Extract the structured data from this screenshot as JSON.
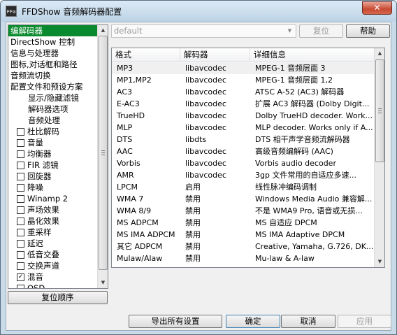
{
  "window": {
    "title": "FFDShow 音频解码器配置",
    "icon_label": "FFa",
    "close_label": "✕"
  },
  "tree": {
    "items": [
      {
        "label": "编解码器",
        "kind": "top",
        "selected": true
      },
      {
        "label": "DirectShow 控制",
        "kind": "top"
      },
      {
        "label": "信息与处理器",
        "kind": "top"
      },
      {
        "label": "图标,对话框和路径",
        "kind": "top"
      },
      {
        "label": "音频流切换",
        "kind": "top"
      },
      {
        "label": "配置文件和预设方案",
        "kind": "top"
      },
      {
        "label": "显示/隐藏滤镜",
        "kind": "sub"
      },
      {
        "label": "解码器选项",
        "kind": "sub"
      },
      {
        "label": "音频处理",
        "kind": "sub"
      },
      {
        "label": "杜比解码",
        "kind": "check",
        "checked": false
      },
      {
        "label": "音量",
        "kind": "check",
        "checked": false
      },
      {
        "label": "均衡器",
        "kind": "check",
        "checked": false
      },
      {
        "label": "FIR 滤镜",
        "kind": "check",
        "checked": false
      },
      {
        "label": "回旋器",
        "kind": "check",
        "checked": false
      },
      {
        "label": "降噪",
        "kind": "check",
        "checked": false
      },
      {
        "label": "Winamp 2",
        "kind": "check",
        "checked": false
      },
      {
        "label": "声场效果",
        "kind": "check",
        "checked": false
      },
      {
        "label": "晶化效果",
        "kind": "check",
        "checked": false
      },
      {
        "label": "重采样",
        "kind": "check",
        "checked": false
      },
      {
        "label": "延迟",
        "kind": "check",
        "checked": false
      },
      {
        "label": "低音交叠",
        "kind": "check",
        "checked": false
      },
      {
        "label": "交换声道",
        "kind": "check",
        "checked": false
      },
      {
        "label": "混音",
        "kind": "check",
        "checked": true
      },
      {
        "label": "OSD",
        "kind": "check",
        "checked": false
      }
    ],
    "reset_order_label": "复位顺序"
  },
  "preset": {
    "value": "default",
    "reset_label": "复位",
    "help_label": "帮助"
  },
  "table": {
    "headers": [
      "格式",
      "解码器",
      "详细信息"
    ],
    "rows": [
      [
        "MP3",
        "libavcodec",
        "MPEG-1 音频层面 3"
      ],
      [
        "MP1,MP2",
        "libavcodec",
        "MPEG-1 音频层面 1,2"
      ],
      [
        "AC3",
        "libavcodec",
        "ATSC A-52 (AC3) 解码器"
      ],
      [
        "E-AC3",
        "libavcodec",
        "扩展 AC3 解码器 (Dolby Digit..."
      ],
      [
        "TrueHD",
        "libavcodec",
        "Dolby TrueHD decoder. Work..."
      ],
      [
        "MLP",
        "libavcodec",
        "MLP decoder. Works only if A..."
      ],
      [
        "DTS",
        "libdts",
        "DTS 相干声学音频流解码器"
      ],
      [
        "AAC",
        "libavcodec",
        "高级音频编解码 (AAC)"
      ],
      [
        "Vorbis",
        "libavcodec",
        "Vorbis audio decoder"
      ],
      [
        "AMR",
        "libavcodec",
        "3gp 文件常用的自适应多速..."
      ],
      [
        "LPCM",
        "启用",
        "线性脉冲编码调制"
      ],
      [
        "WMA 7",
        "禁用",
        "Windows Media Audio 兼容解..."
      ],
      [
        "WMA 8/9",
        "禁用",
        "不是 WMA9 Pro, 语音或无损..."
      ],
      [
        "MS ADPCM",
        "禁用",
        "MS 自适应 DPCM"
      ],
      [
        "MS IMA ADPCM",
        "禁用",
        "MS IMA Adaptive DPCM"
      ],
      [
        "其它 ADPCM",
        "禁用",
        "Creative, Yamaha, G.726, DK..."
      ],
      [
        "Mulaw/Alaw",
        "禁用",
        "Mu-law & A-law"
      ]
    ]
  },
  "footer": {
    "export_label": "导出所有设置",
    "ok_label": "确定",
    "cancel_label": "取消",
    "apply_label": "应用"
  }
}
